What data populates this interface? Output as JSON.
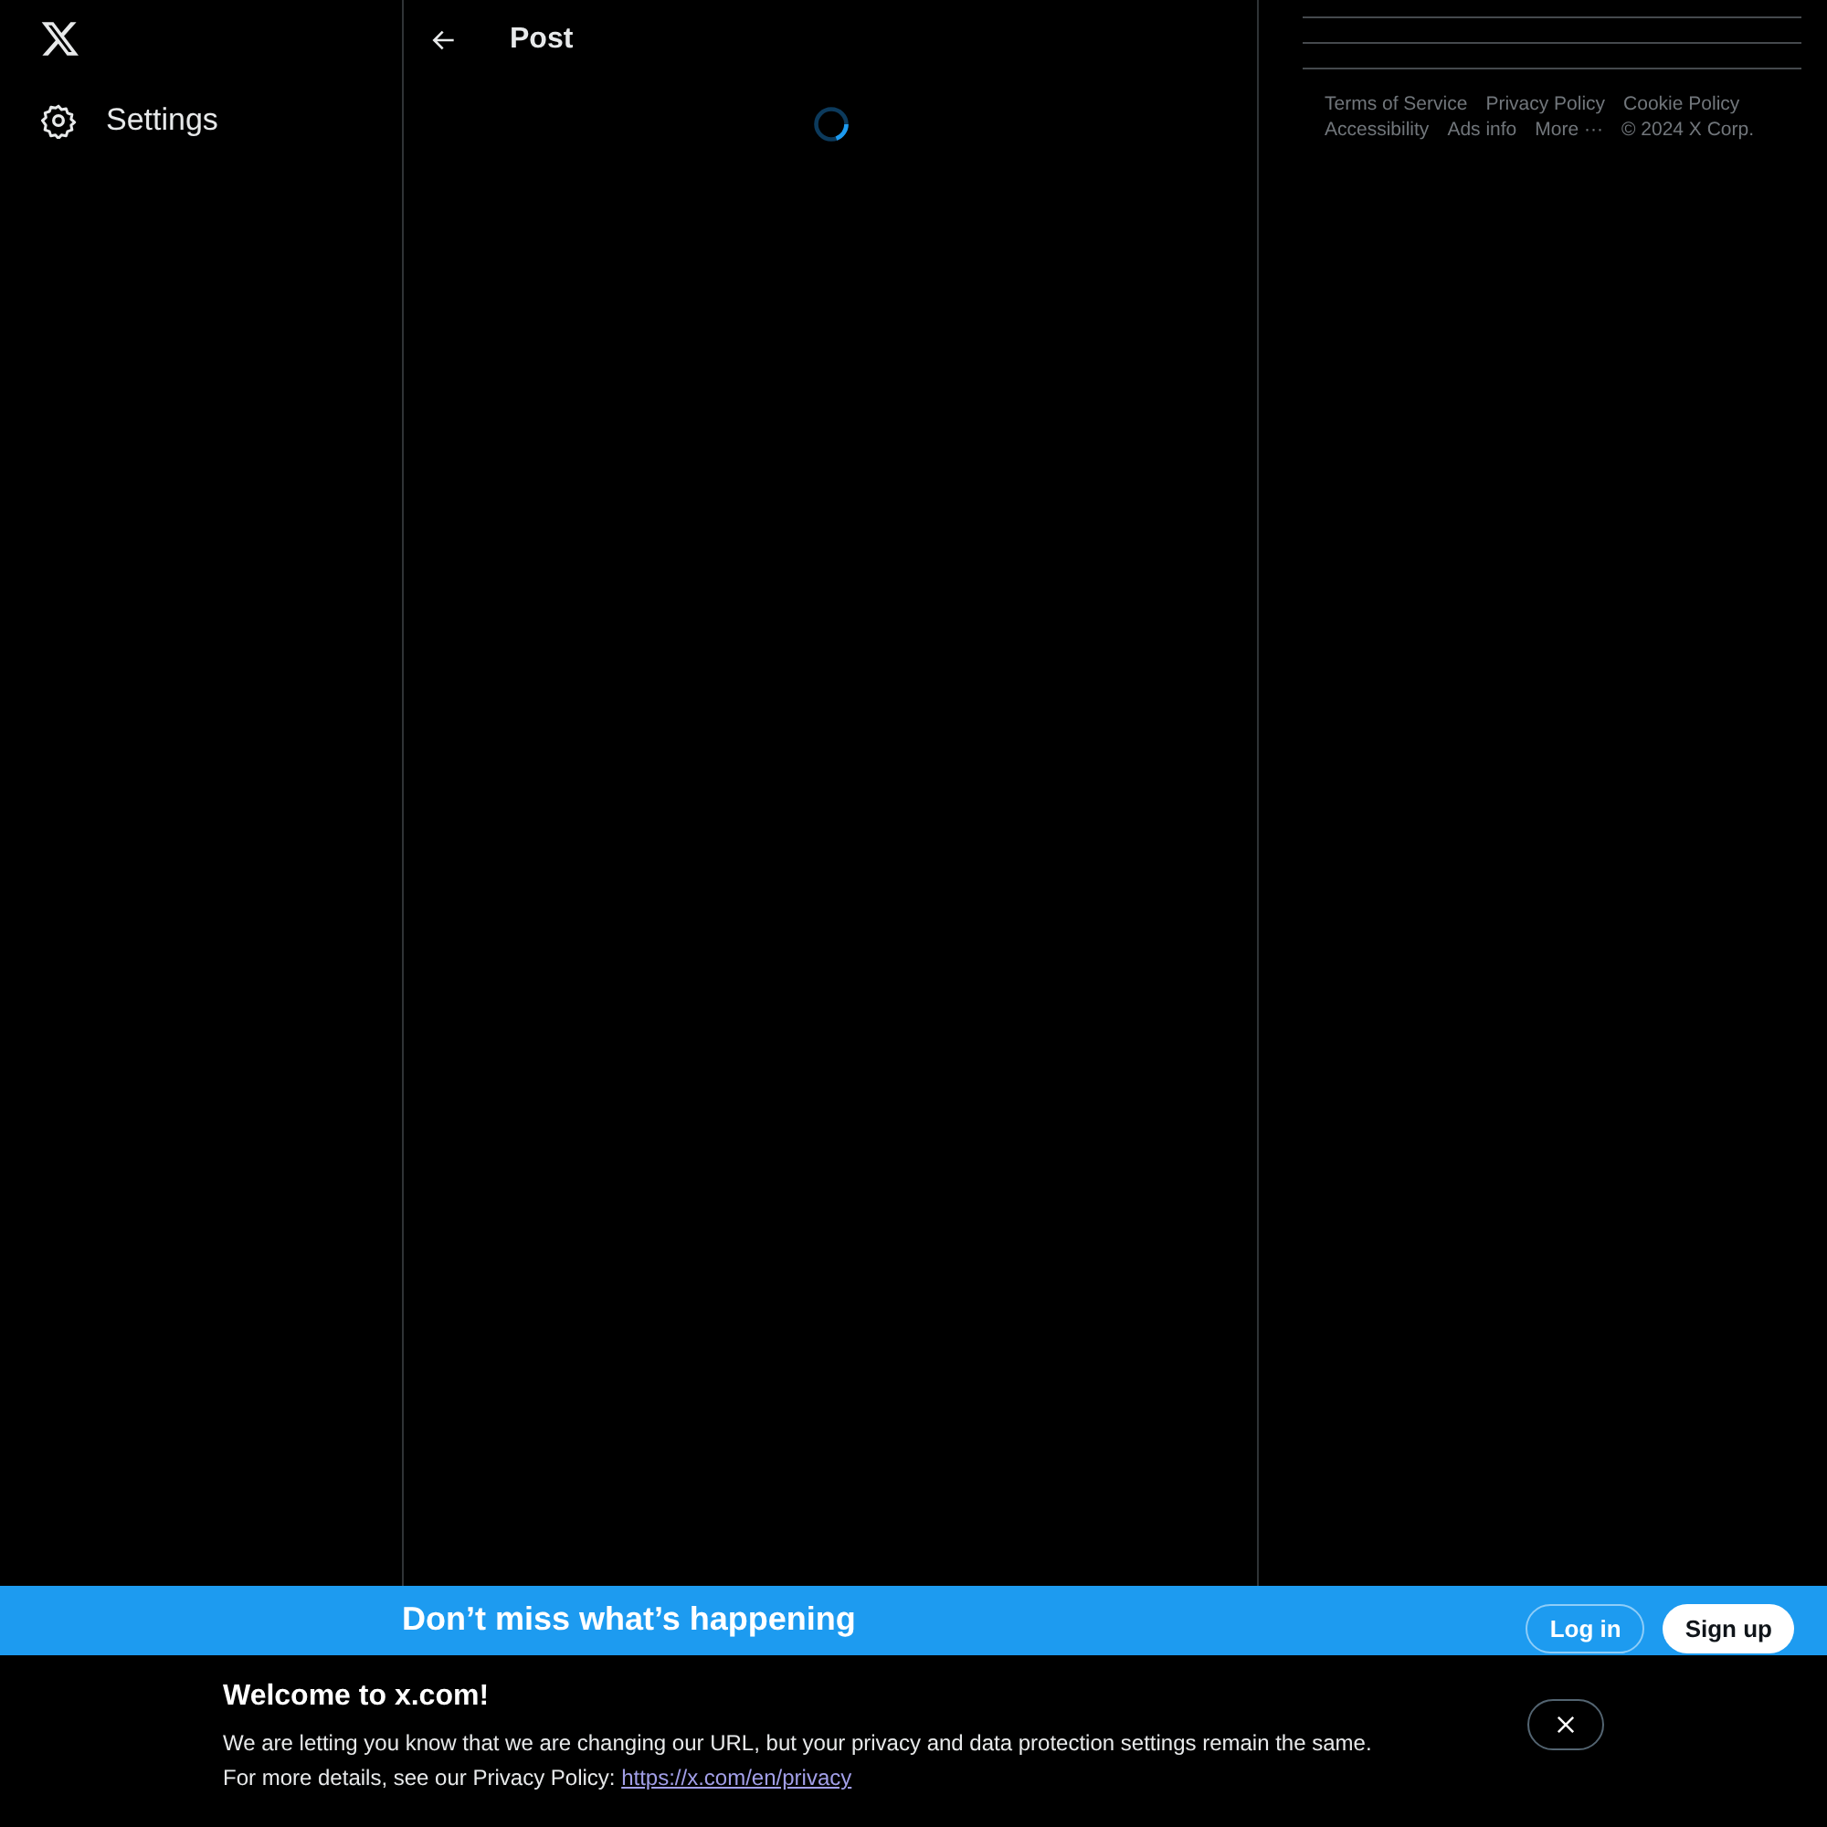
{
  "sidebar": {
    "items": [
      {
        "label": "Settings"
      }
    ]
  },
  "header": {
    "title": "Post"
  },
  "footer_links": [
    "Terms of Service",
    "Privacy Policy",
    "Cookie Policy",
    "Accessibility",
    "Ads info",
    "More ···"
  ],
  "copyright": "© 2024 X Corp.",
  "signup_bar": {
    "title": "Don’t miss what’s happening",
    "buttons": [
      "Log in",
      "Sign up"
    ]
  },
  "cookie_banner": {
    "title": "Welcome to x.com!",
    "text": "We are letting you know that we are changing our URL, but your privacy and data protection settings remain the same.",
    "text2": "For more details, see our Privacy Policy:",
    "link": "https://x.com/en/privacy"
  }
}
